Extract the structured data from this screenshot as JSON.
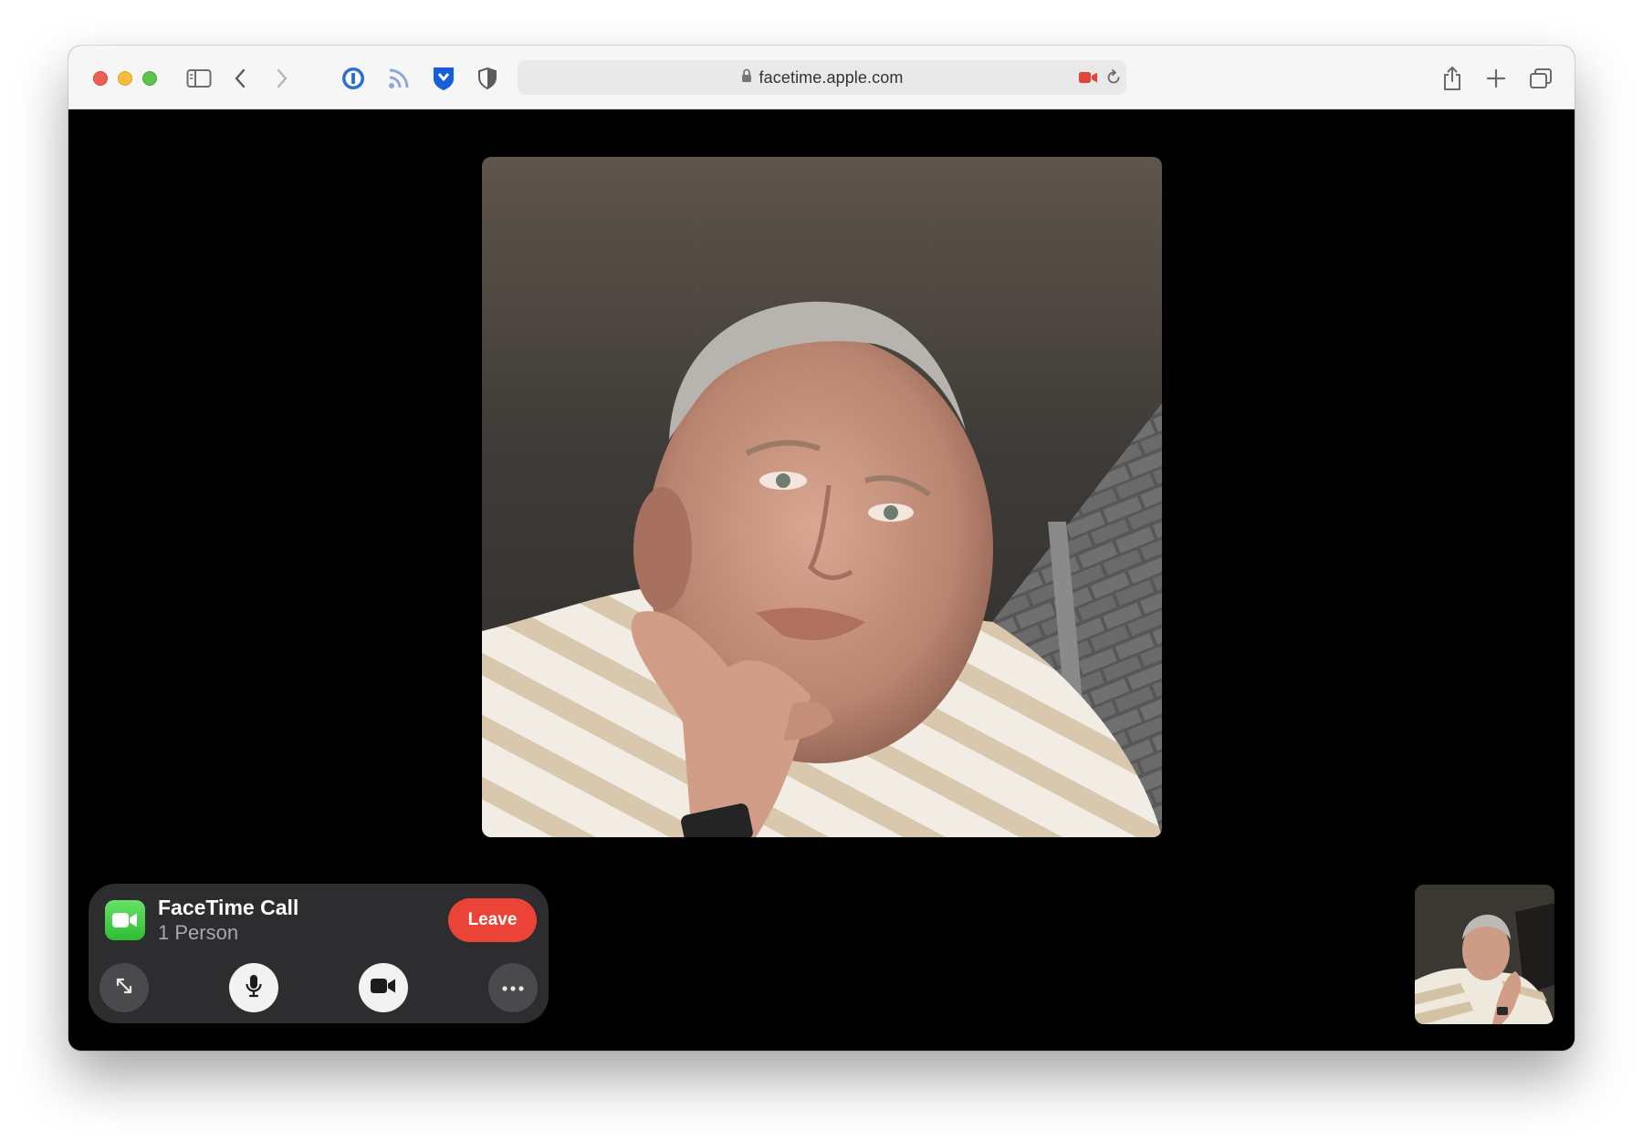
{
  "browser": {
    "url": "facetime.apple.com",
    "toolbar_icons": [
      "sidebar-icon",
      "back-icon",
      "forward-icon",
      "1password-icon",
      "rss-icon",
      "bitwarden-icon",
      "privacy-shield-icon",
      "share-icon",
      "new-tab-icon",
      "tab-overview-icon"
    ],
    "colors": {
      "camera_indicator": "#e0463a"
    }
  },
  "call": {
    "title": "FaceTime Call",
    "participants": "1 Person",
    "leave_label": "Leave",
    "controls": [
      "fullscreen-icon",
      "microphone-icon",
      "camera-icon",
      "more-icon"
    ],
    "colors": {
      "leave": "#eb4437",
      "facetime_green": "#34c759",
      "panel": "#2d2d2f"
    }
  }
}
